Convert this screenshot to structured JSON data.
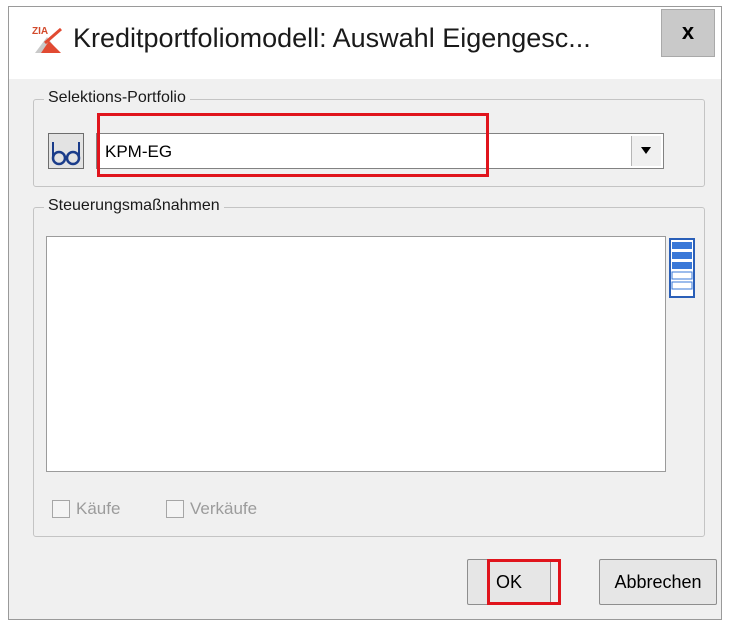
{
  "window": {
    "title": "Kreditportfoliomodell: Auswahl Eigengesc...",
    "app_icon": "zia-app-icon",
    "app_icon_text": "ZIA",
    "close_label": "x"
  },
  "selection_group": {
    "legend": "Selektions-Portfolio",
    "lookup_icon": "glasses-icon",
    "portfolio_value": "KPM-EG",
    "dropdown_icon": "chevron-down-icon"
  },
  "measures_group": {
    "legend": "Steuerungsmaßnahmen",
    "list_items": [],
    "select_all_icon": "list-select-icon",
    "buys_label": "Käufe",
    "buys_checked": false,
    "sells_label": "Verkäufe",
    "sells_checked": false
  },
  "buttons": {
    "ok_label": "OK",
    "cancel_label": "Abbrechen"
  },
  "colors": {
    "highlight": "#e0141c",
    "window_bg": "#f0f0f0",
    "list_icon_blue": "#3a78d8"
  }
}
